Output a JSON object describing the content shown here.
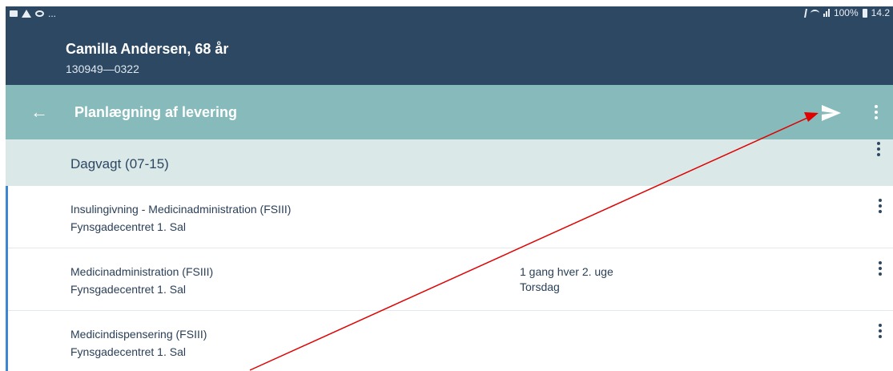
{
  "status_bar": {
    "left_more": "...",
    "battery_text": "100%",
    "time": "14.2"
  },
  "patient": {
    "name": "Camilla Andersen, 68 år",
    "id": "130949—0322"
  },
  "toolbar": {
    "back_icon": "arrow-left-icon",
    "title": "Planlægning af levering",
    "send_icon": "send-icon",
    "menu_icon": "more-vertical-icon"
  },
  "section": {
    "label": "Dagvagt (07-15)"
  },
  "items": [
    {
      "title": "Insulingivning - Medicinadministration (FSIII)",
      "location": "Fynsgadecentret 1. Sal",
      "frequency": "",
      "day": ""
    },
    {
      "title": "Medicinadministration (FSIII)",
      "location": "Fynsgadecentret 1. Sal",
      "frequency": "1 gang hver 2. uge",
      "day": "Torsdag"
    },
    {
      "title": "Medicindispensering (FSIII)",
      "location": "Fynsgadecentret 1. Sal",
      "frequency": "",
      "day": ""
    }
  ],
  "colors": {
    "header": "#2d4863",
    "toolbar": "#87baba",
    "section": "#dbe8e8",
    "accent_line": "#3d86d4",
    "annotation_arrow": "#e00000"
  }
}
